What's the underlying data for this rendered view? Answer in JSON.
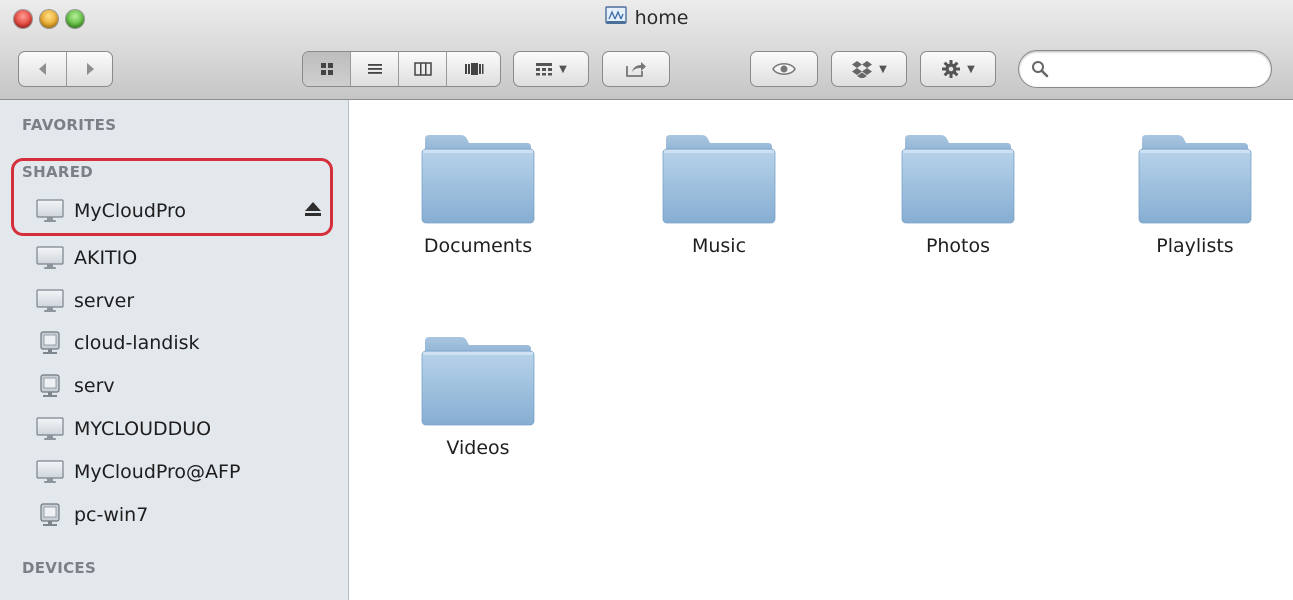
{
  "window": {
    "title": "home"
  },
  "toolbar": {
    "view_modes": [
      "icon-view",
      "list-view",
      "column-view",
      "cover-flow-view"
    ],
    "active_view": "icon-view",
    "search": {
      "value": "",
      "placeholder": ""
    }
  },
  "sidebar": {
    "sections": {
      "favorites": "FAVORITES",
      "shared": "SHARED",
      "devices": "DEVICES"
    },
    "shared_items": [
      {
        "label": "MyCloudPro",
        "icon": "display-icon",
        "ejectable": true
      },
      {
        "label": "AKITIO",
        "icon": "display-icon"
      },
      {
        "label": "server",
        "icon": "display-icon"
      },
      {
        "label": "cloud-landisk",
        "icon": "pc-server-icon"
      },
      {
        "label": "serv",
        "icon": "pc-server-icon"
      },
      {
        "label": "MYCLOUDDUO",
        "icon": "display-icon"
      },
      {
        "label": "MyCloudPro@AFP",
        "icon": "display-icon"
      },
      {
        "label": "pc-win7",
        "icon": "pc-server-icon"
      }
    ],
    "highlight_color": "#d42f3b"
  },
  "content": {
    "folders": [
      {
        "label": "Documents"
      },
      {
        "label": "Music"
      },
      {
        "label": "Photos"
      },
      {
        "label": "Playlists"
      },
      {
        "label": "Videos"
      }
    ]
  }
}
